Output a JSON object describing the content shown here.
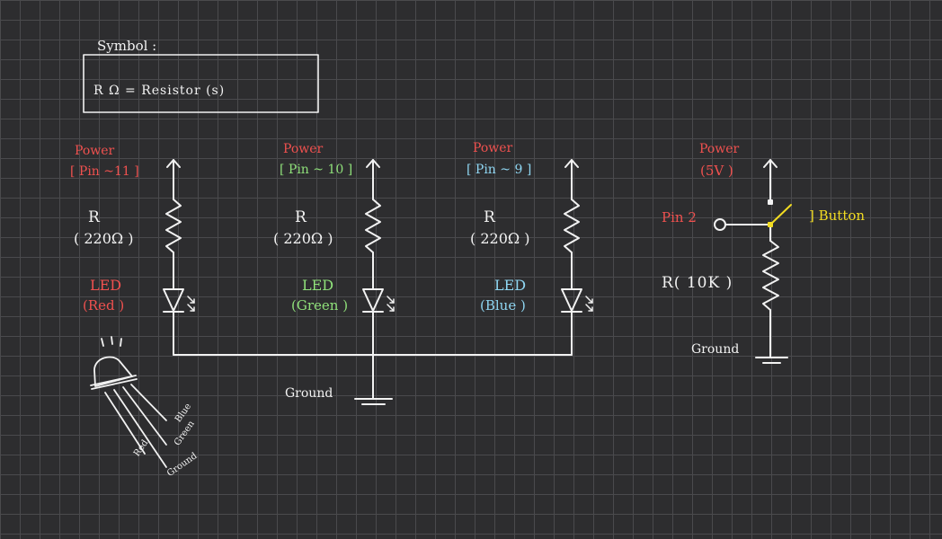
{
  "colors": {
    "background": "#2d2d2f",
    "grid": "#4a4a4d",
    "wire": "#f2f2f2",
    "red": "#f0514f",
    "green": "#8fe07a",
    "blue": "#8fd6f2",
    "yellow": "#f2dc22"
  },
  "legend": {
    "title": "Symbol :",
    "line": "R Ω = Resistor (s)"
  },
  "circuits": [
    {
      "power": "Power",
      "pin": "[ Pin ~11 ]",
      "r_label": "R",
      "r_value": "( 220Ω )",
      "led_label": "LED",
      "led_color": "(Red )",
      "color": "red"
    },
    {
      "power": "Power",
      "pin": "[ Pin ~ 10 ]",
      "r_label": "R",
      "r_value": "( 220Ω )",
      "led_label": "LED",
      "led_color": "(Green )",
      "color": "green"
    },
    {
      "power": "Power",
      "pin": "[ Pin ~ 9 ]",
      "r_label": "R",
      "r_value": "( 220Ω )",
      "led_label": "LED",
      "led_color": "(Blue )",
      "color": "blue"
    }
  ],
  "ground_label": "Ground",
  "button_circuit": {
    "power": "Power",
    "voltage": "(5V )",
    "pin": "Pin 2",
    "button_label": "] Button",
    "resistor_label": "R( 10K )",
    "ground_label": "Ground"
  },
  "rgb_led": {
    "legs": [
      "Red",
      "Ground",
      "Green",
      "Blue"
    ]
  }
}
